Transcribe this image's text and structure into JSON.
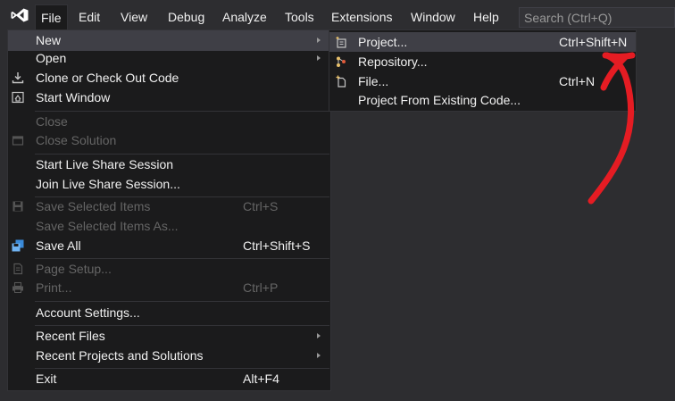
{
  "menubar": {
    "items": [
      "File",
      "Edit",
      "View",
      "Debug",
      "Analyze",
      "Tools",
      "Extensions",
      "Window",
      "Help"
    ],
    "search_placeholder": "Search (Ctrl+Q)"
  },
  "file_menu": {
    "items": [
      {
        "label": "New",
        "shortcut": "",
        "submenu": true,
        "disabled": false,
        "icon": ""
      },
      {
        "label": "Open",
        "shortcut": "",
        "submenu": true,
        "disabled": false,
        "icon": ""
      },
      {
        "label": "Clone or Check Out Code",
        "shortcut": "",
        "submenu": false,
        "disabled": false,
        "icon": "download-icon"
      },
      {
        "label": "Start Window",
        "shortcut": "",
        "submenu": false,
        "disabled": false,
        "icon": "start-window-icon"
      },
      {
        "label": "Close",
        "shortcut": "",
        "submenu": false,
        "disabled": true,
        "icon": ""
      },
      {
        "label": "Close Solution",
        "shortcut": "",
        "submenu": false,
        "disabled": true,
        "icon": "close-solution-icon"
      },
      {
        "label": "Start Live Share Session",
        "shortcut": "",
        "submenu": false,
        "disabled": false,
        "icon": ""
      },
      {
        "label": "Join Live Share Session...",
        "shortcut": "",
        "submenu": false,
        "disabled": false,
        "icon": ""
      },
      {
        "label": "Save Selected Items",
        "shortcut": "Ctrl+S",
        "submenu": false,
        "disabled": true,
        "icon": "save-icon"
      },
      {
        "label": "Save Selected Items As...",
        "shortcut": "",
        "submenu": false,
        "disabled": true,
        "icon": ""
      },
      {
        "label": "Save All",
        "shortcut": "Ctrl+Shift+S",
        "submenu": false,
        "disabled": false,
        "icon": "save-all-icon"
      },
      {
        "label": "Page Setup...",
        "shortcut": "",
        "submenu": false,
        "disabled": true,
        "icon": "page-setup-icon"
      },
      {
        "label": "Print...",
        "shortcut": "Ctrl+P",
        "submenu": false,
        "disabled": true,
        "icon": "print-icon"
      },
      {
        "label": "Account Settings...",
        "shortcut": "",
        "submenu": false,
        "disabled": false,
        "icon": ""
      },
      {
        "label": "Recent Files",
        "shortcut": "",
        "submenu": true,
        "disabled": false,
        "icon": ""
      },
      {
        "label": "Recent Projects and Solutions",
        "shortcut": "",
        "submenu": true,
        "disabled": false,
        "icon": ""
      },
      {
        "label": "Exit",
        "shortcut": "Alt+F4",
        "submenu": false,
        "disabled": false,
        "icon": ""
      }
    ]
  },
  "new_submenu": {
    "items": [
      {
        "label": "Project...",
        "shortcut": "Ctrl+Shift+N",
        "icon": "new-project-icon"
      },
      {
        "label": "Repository...",
        "shortcut": "",
        "icon": "repository-icon"
      },
      {
        "label": "File...",
        "shortcut": "Ctrl+N",
        "icon": "new-file-icon"
      },
      {
        "label": "Project From Existing Code...",
        "shortcut": "",
        "icon": ""
      }
    ]
  },
  "colors": {
    "background": "#2d2d30",
    "menu_background": "#1b1b1c",
    "highlight": "#3f3f46",
    "disabled_text": "#656565",
    "annotation_red": "#e51c23",
    "vs_purple": "#ffffff"
  }
}
